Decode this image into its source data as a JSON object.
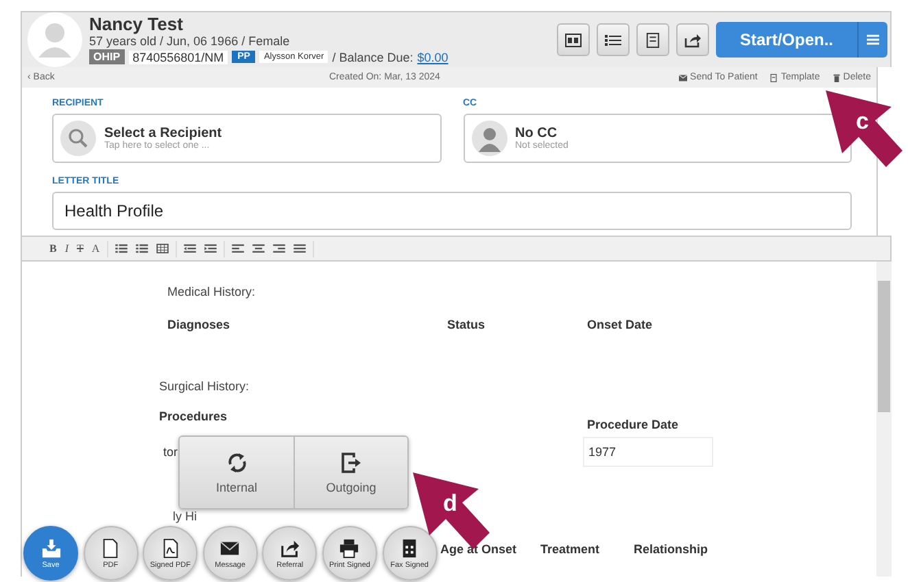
{
  "patient": {
    "name": "Nancy Test",
    "details": "57 years old / Jun, 06 1966 / Female",
    "id_badge": "OHIP",
    "id_number": "8740556801/NM",
    "provider_badge": "PP",
    "provider": "Alysson Korver",
    "balance_label": "/ Balance Due:",
    "balance": "$0.00"
  },
  "header_buttons": [
    {
      "kind": "card"
    },
    {
      "kind": "list"
    },
    {
      "kind": "doc"
    },
    {
      "kind": "share"
    }
  ],
  "start_button": "Start/Open..",
  "subbar": {
    "back": "‹ Back",
    "created": "Created On: Mar, 13 2024",
    "actions": [
      {
        "kind": "mail",
        "label": "Send To Patient"
      },
      {
        "kind": "template",
        "label": "Template"
      },
      {
        "kind": "trash",
        "label": "Delete"
      }
    ]
  },
  "recipient": {
    "label": "RECIPIENT",
    "title": "Select a Recipient",
    "hint": "Tap here to select one ..."
  },
  "cc": {
    "label": "CC",
    "title": "No CC",
    "hint": "Not selected"
  },
  "letter_title": {
    "label": "LETTER TITLE",
    "value": "Health Profile"
  },
  "toolbar": [
    [
      {
        "kind": "bold",
        "glyph": "B"
      },
      {
        "kind": "italic",
        "glyph": "I"
      },
      {
        "kind": "strike",
        "glyph": "T"
      },
      {
        "kind": "color",
        "glyph": "A"
      }
    ],
    [
      {
        "kind": "ul"
      },
      {
        "kind": "ol"
      },
      {
        "kind": "table"
      }
    ],
    [
      {
        "kind": "outdent"
      },
      {
        "kind": "indent"
      }
    ],
    [
      {
        "kind": "left"
      },
      {
        "kind": "center"
      },
      {
        "kind": "right"
      },
      {
        "kind": "justify"
      }
    ]
  ],
  "document": {
    "medical_heading": "Medical History:",
    "medical_columns": [
      "Diagnoses",
      "Status",
      "Onset Date"
    ],
    "surgical_heading": "Surgical History:",
    "surgical_columns": [
      "Procedures",
      "Procedure Date"
    ],
    "surgical_row": [
      "tor",
      "1977"
    ],
    "family_heading": "ly Hi",
    "family_columns": [
      "Age at Onset",
      "Treatment",
      "Relationship"
    ]
  },
  "share_menu": [
    {
      "kind": "internal",
      "label": "Internal"
    },
    {
      "kind": "outgoing",
      "label": "Outgoing"
    }
  ],
  "actions": [
    {
      "kind": "save",
      "label": "Save",
      "primary": true
    },
    {
      "kind": "pdf",
      "label": "PDF",
      "primary": false
    },
    {
      "kind": "signed_pdf",
      "label": "Signed PDF",
      "primary": false
    },
    {
      "kind": "message",
      "label": "Message",
      "primary": false
    },
    {
      "kind": "referral",
      "label": "Referral",
      "primary": false
    },
    {
      "kind": "print",
      "label": "Print Signed",
      "primary": false
    },
    {
      "kind": "fax",
      "label": "Fax Signed",
      "primary": false
    }
  ],
  "callouts": [
    {
      "label": "c"
    },
    {
      "label": "d"
    }
  ]
}
